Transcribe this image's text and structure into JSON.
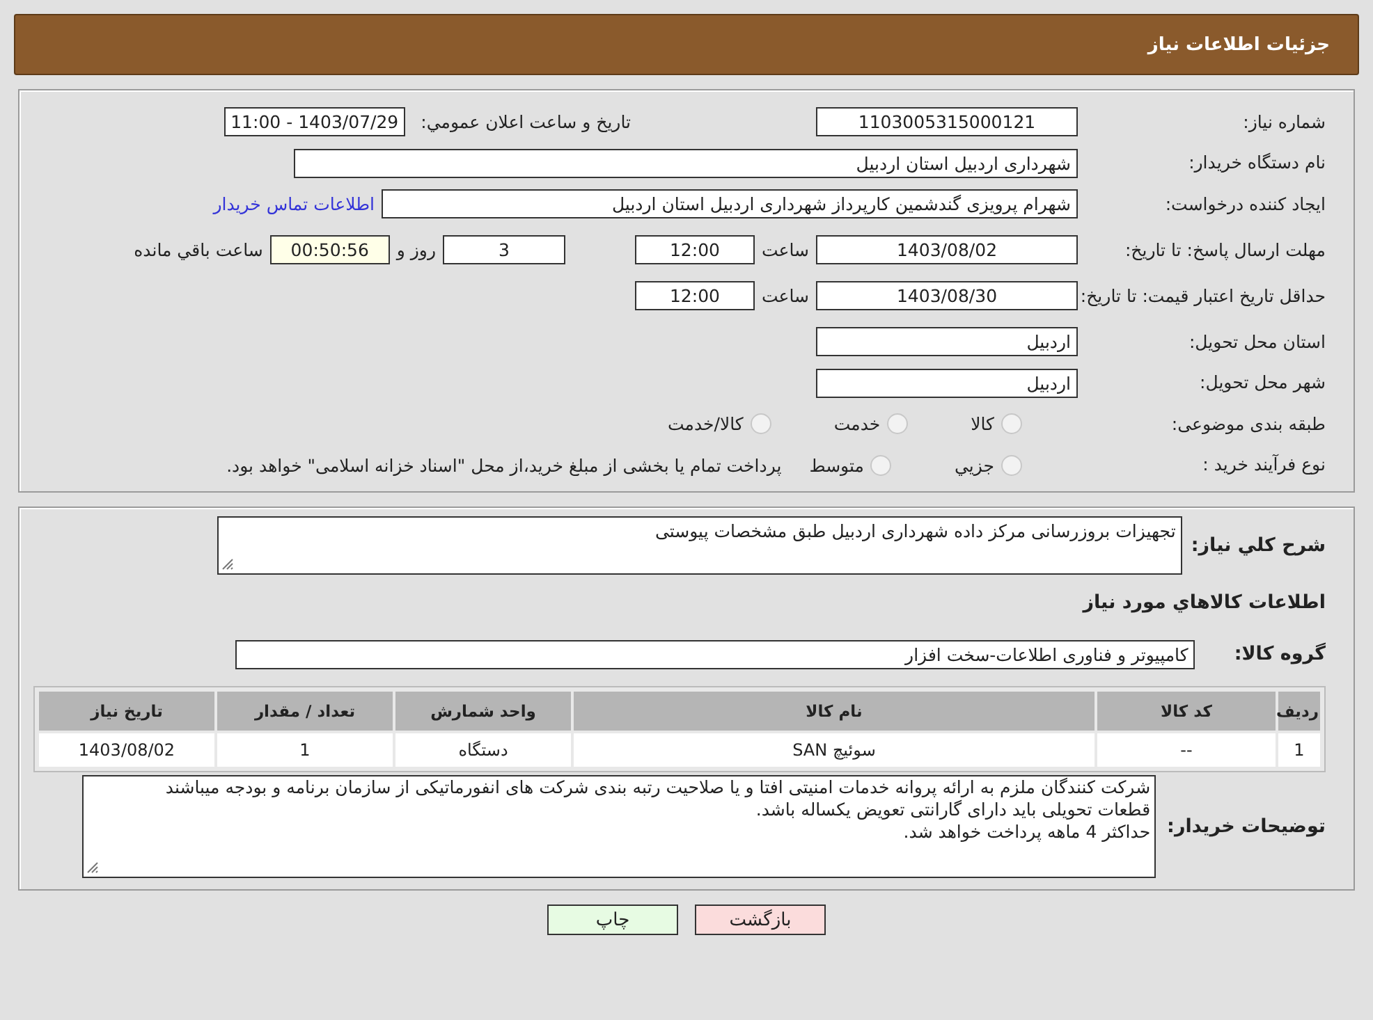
{
  "header": {
    "title": "جزئیات اطلاعات نیاز"
  },
  "details": {
    "need_number": {
      "label": "شماره نیاز:",
      "value": "1103005315000121"
    },
    "announce": {
      "label": "تاريخ و ساعت اعلان عمومي:",
      "value": "1403/07/29 - 11:00"
    },
    "buyer_org": {
      "label": "نام دستگاه خریدار:",
      "value": "شهرداری اردبیل استان اردبیل"
    },
    "requester": {
      "label": "ایجاد کننده درخواست:",
      "value": "شهرام پرویزی گندشمین کارپرداز شهرداری اردبیل استان اردبیل",
      "contact_link": "اطلاعات تماس خریدار"
    },
    "reply_deadline": {
      "label": "مهلت ارسال پاسخ: تا تاریخ:",
      "date": "1403/08/02",
      "time_label": "ساعت",
      "time": "12:00",
      "days": "3",
      "days_label": "روز و",
      "remaining": "00:50:56",
      "remaining_label": "ساعت باقي مانده"
    },
    "price_validity": {
      "label": "حداقل تاریخ اعتبار قیمت: تا تاریخ:",
      "date": "1403/08/30",
      "time_label": "ساعت",
      "time": "12:00"
    },
    "province": {
      "label": "استان محل تحویل:",
      "value": "اردبیل"
    },
    "city": {
      "label": "شهر محل تحویل:",
      "value": "اردبیل"
    },
    "category": {
      "label": "طبقه بندی موضوعی:",
      "options": [
        {
          "label": "کالا",
          "selected": false
        },
        {
          "label": "خدمت",
          "selected": false
        },
        {
          "label": "کالا/خدمت",
          "selected": false
        }
      ]
    },
    "purchase_type": {
      "label": "نوع فرآیند خرید :",
      "options": [
        {
          "label": "جزيي",
          "selected": false
        },
        {
          "label": "متوسط",
          "selected": false
        }
      ],
      "note": "پرداخت تمام یا بخشی از مبلغ خرید،از محل \"اسناد خزانه اسلامی\" خواهد بود."
    }
  },
  "summary": {
    "label": "شرح کلي نياز:",
    "value": "تجهیزات بروزرسانی مرکز داده شهرداری اردبیل طبق مشخصات پیوستی"
  },
  "goods_heading": "اطلاعات کالاهاي مورد نياز",
  "goods_group": {
    "label": "گروه کالا:",
    "value": "کامپیوتر و فناوری اطلاعات-سخت افزار"
  },
  "table": {
    "columns": [
      "رديف",
      "کد کالا",
      "نام کالا",
      "واحد شمارش",
      "تعداد / مقدار",
      "تاريخ نياز"
    ],
    "rows": [
      [
        "1",
        "--",
        "سوئیچ SAN",
        "دستگاه",
        "1",
        "1403/08/02"
      ]
    ]
  },
  "buyer_notes": {
    "label": "توضیحات خریدار:",
    "lines": [
      "شرکت کنندگان ملزم به ارائه پروانه خدمات امنیتی افتا و یا صلاحیت رتبه بندی شرکت های انفورماتیکی از سازمان برنامه و بودجه میباشند",
      "قطعات تحویلی باید دارای گارانتی تعویض یکساله باشد.",
      "حداکثر 4 ماهه پرداخت خواهد شد."
    ]
  },
  "buttons": [
    {
      "label": "بازگشت",
      "kind": "back"
    },
    {
      "label": "چاپ",
      "kind": "print"
    }
  ]
}
